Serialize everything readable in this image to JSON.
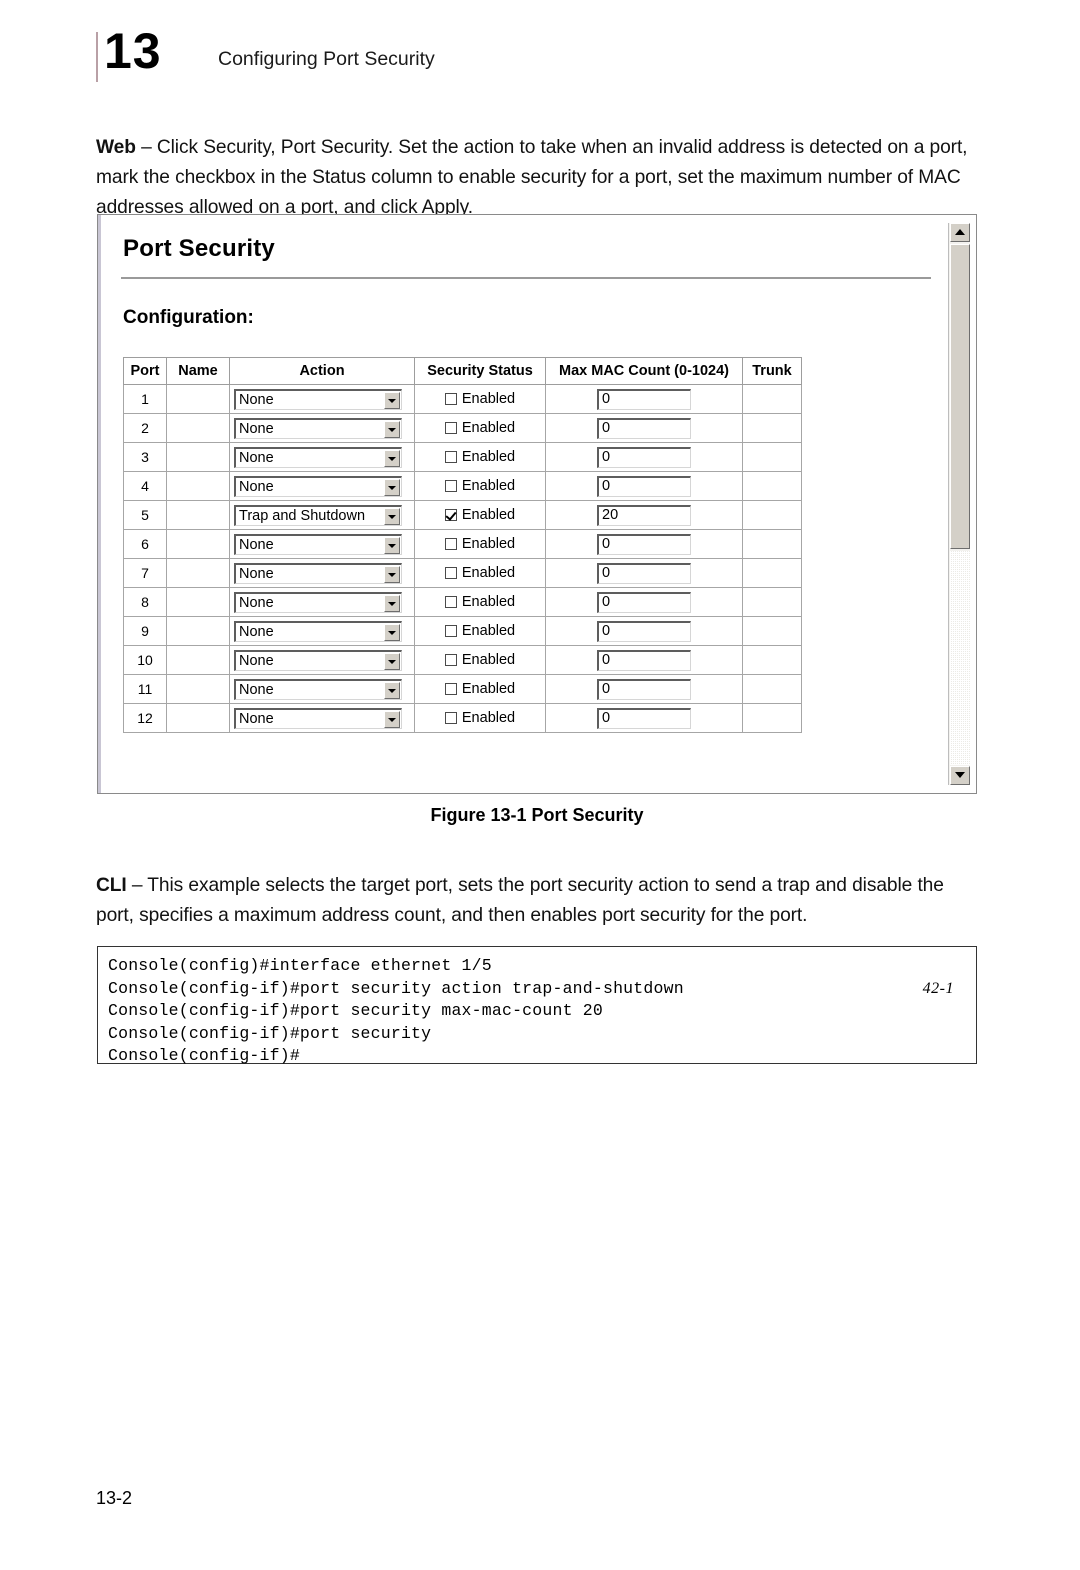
{
  "page": {
    "chapter_number": "13",
    "running_head": "Configuring Port Security",
    "footer": "13-2"
  },
  "web_section": {
    "lead": "Web",
    "text": " – Click Security, Port Security. Set the action to take when an invalid address is detected on a port, mark the checkbox in the Status column to enable security for a port, set the maximum number of MAC addresses allowed on a port, and click Apply."
  },
  "ui_panel": {
    "title": "Port Security",
    "subtitle": "Configuration:",
    "table": {
      "headers": [
        "Port",
        "Name",
        "Action",
        "Security Status",
        "Max MAC Count (0-1024)",
        "Trunk"
      ],
      "status_label": "Enabled",
      "rows": [
        {
          "port": "1",
          "name": "",
          "action": "None",
          "enabled": false,
          "max_mac": "0",
          "trunk": ""
        },
        {
          "port": "2",
          "name": "",
          "action": "None",
          "enabled": false,
          "max_mac": "0",
          "trunk": ""
        },
        {
          "port": "3",
          "name": "",
          "action": "None",
          "enabled": false,
          "max_mac": "0",
          "trunk": ""
        },
        {
          "port": "4",
          "name": "",
          "action": "None",
          "enabled": false,
          "max_mac": "0",
          "trunk": ""
        },
        {
          "port": "5",
          "name": "",
          "action": "Trap and Shutdown",
          "enabled": true,
          "max_mac": "20",
          "trunk": ""
        },
        {
          "port": "6",
          "name": "",
          "action": "None",
          "enabled": false,
          "max_mac": "0",
          "trunk": ""
        },
        {
          "port": "7",
          "name": "",
          "action": "None",
          "enabled": false,
          "max_mac": "0",
          "trunk": ""
        },
        {
          "port": "8",
          "name": "",
          "action": "None",
          "enabled": false,
          "max_mac": "0",
          "trunk": ""
        },
        {
          "port": "9",
          "name": "",
          "action": "None",
          "enabled": false,
          "max_mac": "0",
          "trunk": ""
        },
        {
          "port": "10",
          "name": "",
          "action": "None",
          "enabled": false,
          "max_mac": "0",
          "trunk": ""
        },
        {
          "port": "11",
          "name": "",
          "action": "None",
          "enabled": false,
          "max_mac": "0",
          "trunk": ""
        },
        {
          "port": "12",
          "name": "",
          "action": "None",
          "enabled": false,
          "max_mac": "0",
          "trunk": ""
        }
      ]
    },
    "scrollbar": {
      "up_icon": "scroll-up-arrow-icon",
      "down_icon": "scroll-down-arrow-icon"
    }
  },
  "figure": {
    "caption": "Figure 13-1  Port Security"
  },
  "cli_section": {
    "lead": "CLI",
    "text": " – This example selects the target port, sets the port security action to send a trap and disable the port, specifies a maximum address count, and then enables port security for the port."
  },
  "cli_console": {
    "lines": [
      {
        "text": "Console(config)#interface ethernet 1/5",
        "ref": ""
      },
      {
        "text": "Console(config-if)#port security action trap-and-shutdown",
        "ref": "42-1"
      },
      {
        "text": "Console(config-if)#port security max-mac-count 20",
        "ref": ""
      },
      {
        "text": "Console(config-if)#port security",
        "ref": ""
      },
      {
        "text": "Console(config-if)#",
        "ref": ""
      }
    ]
  },
  "colors": {
    "chapter_rule": "#b9a0a6",
    "panel_border": "#8a8a8a",
    "widget_face": "#d4d0c8"
  }
}
